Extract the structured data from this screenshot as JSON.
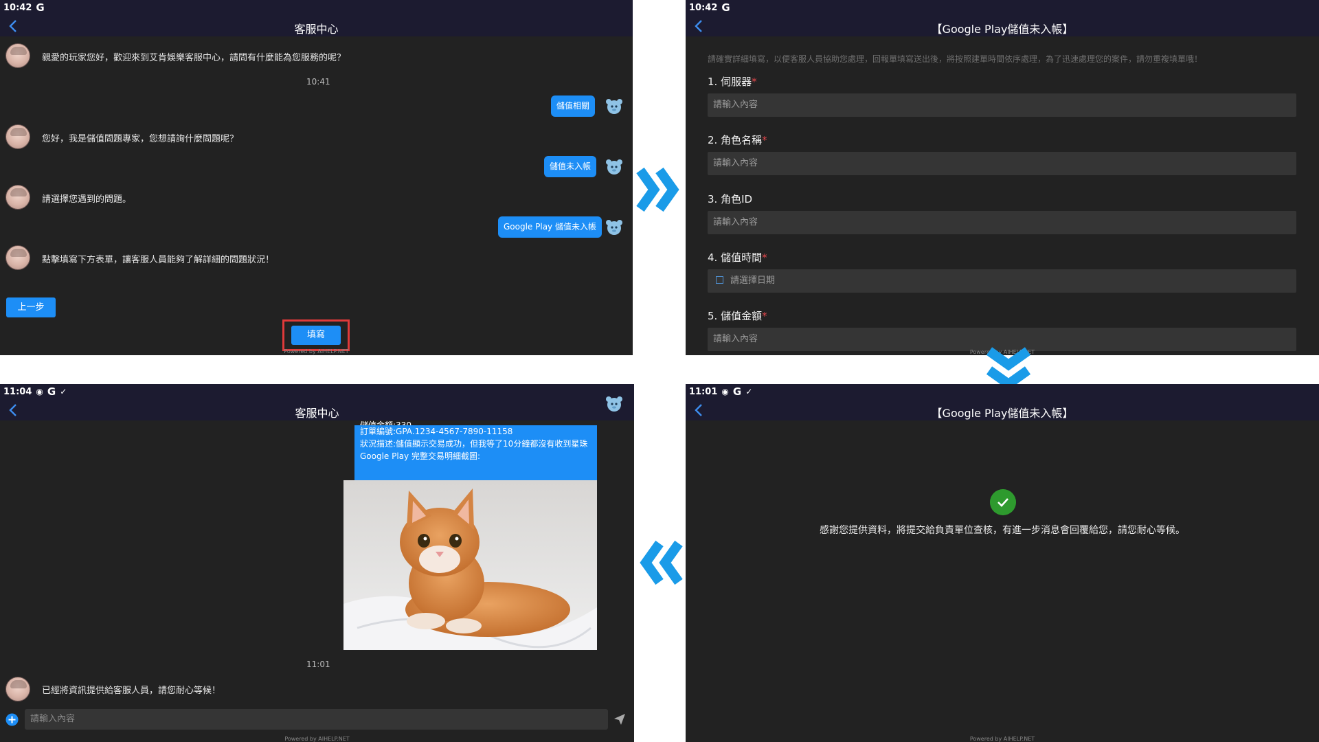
{
  "panel1": {
    "status_time": "10:42",
    "status_g": "G",
    "title": "客服中心",
    "messages": [
      "親愛的玩家您好，歡迎來到艾肯娛樂客服中心，請問有什麼能為您服務的呢？",
      "您好，我是儲值問題專家，您想請詢什麼問題呢？",
      "請選擇您遇到的問題。",
      "點擊填寫下方表單，讓客服人員能夠了解詳細的問題狀況！"
    ],
    "timestamp": "10:41",
    "replies": [
      "儲值相關",
      "儲值未入帳",
      "Google Play 儲值未入帳"
    ],
    "prev_button": "上一步",
    "fill_button": "填寫",
    "powered": "Powered by AIHELP.NET"
  },
  "panel2": {
    "status_time": "10:42",
    "status_g": "G",
    "title": "【Google Play儲值未入帳】",
    "intro": "請確實詳細填寫，以便客服人員協助您處理，回報單填寫送出後，將按照建單時間依序處理，為了迅速處理您的案件，請勿重複填單哦！",
    "fields": [
      {
        "label": "1. 伺服器",
        "required": "*",
        "placeholder": "請輸入內容"
      },
      {
        "label": "2. 角色名稱",
        "required": "*",
        "placeholder": "請輸入內容"
      },
      {
        "label": "3. 角色ID",
        "required": "",
        "placeholder": "請輸入內容"
      },
      {
        "label": "4. 儲值時間",
        "required": "*",
        "placeholder": "請選擇日期"
      },
      {
        "label": "5. 儲值金額",
        "required": "*",
        "placeholder": "請輸入內容"
      }
    ],
    "powered": "Powered by AIHELP.NET"
  },
  "panel3": {
    "status_time": "11:04",
    "status_g": "G",
    "title": "客服中心",
    "chat_lines": [
      "儲值金額:330",
      "訂單編號:GPA.1234-4567-7890-11158",
      "狀況描述:儲值顯示交易成功，但我等了10分鐘都沒有收到星珠",
      "Google Play 完整交易明細截圖:"
    ],
    "timestamp": "11:01",
    "reply": "已經將資訊提供給客服人員，請您耐心等候！",
    "input_placeholder": "請輸入內容",
    "powered": "Powered by AIHELP.NET"
  },
  "panel4": {
    "status_time": "11:01",
    "status_g": "G",
    "title": "【Google Play儲值未入帳】",
    "message": "感謝您提供資料，將提交給負責單位查核，有進一步消息會回覆給您，請您耐心等候。",
    "powered": "Powered by AIHELP.NET"
  },
  "colors": {
    "accent": "#1d8ef6",
    "topbar": "#1c1b30",
    "panel_bg": "#222222",
    "success": "#2e9a2e",
    "highlight": "#e03a3a"
  },
  "icons": [
    "back-arrow-icon",
    "google-g-icon",
    "bot-avatar-icon",
    "double-chevron-right-icon",
    "double-chevron-down-icon",
    "double-chevron-left-icon",
    "add-circle-icon",
    "send-icon",
    "check-icon",
    "calendar-icon"
  ]
}
